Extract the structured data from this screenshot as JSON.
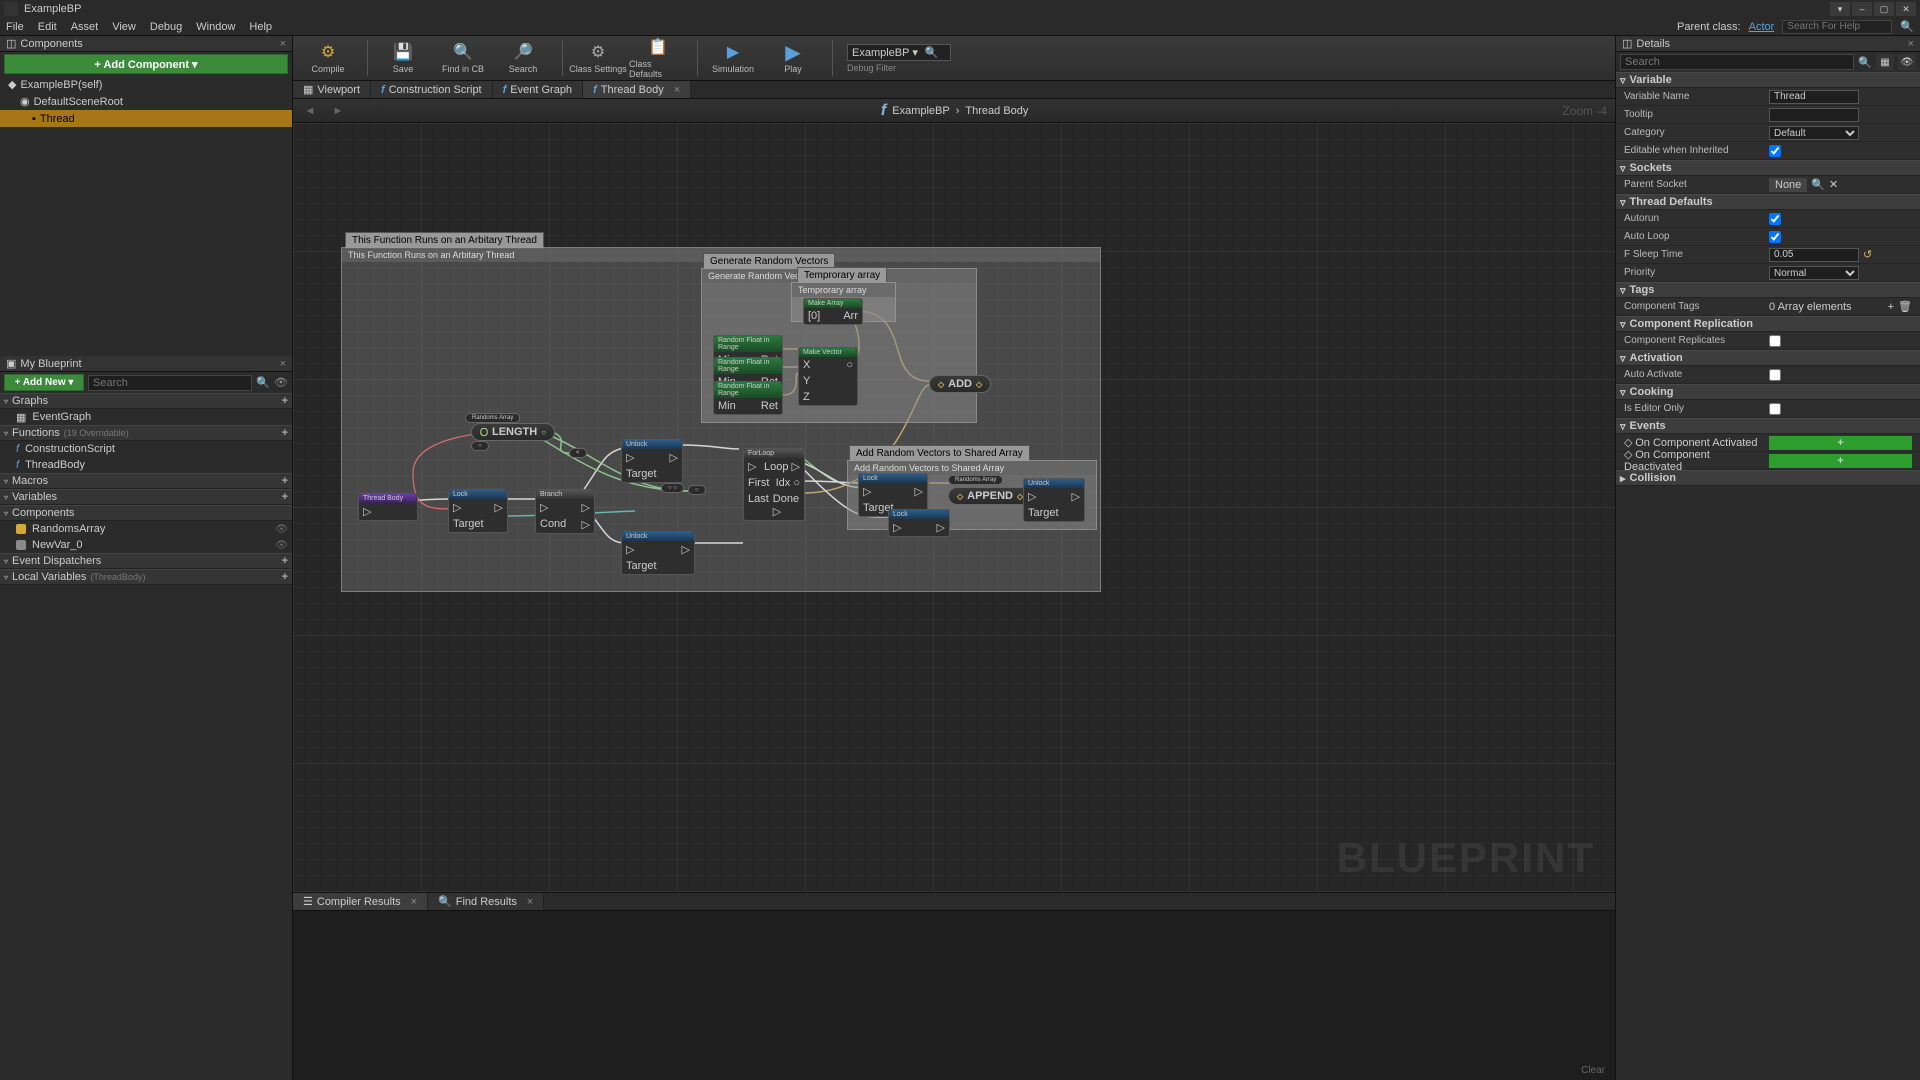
{
  "titlebar": {
    "title": "ExampleBP"
  },
  "window_buttons": {
    "min": "–",
    "max": "▢",
    "close": "✕",
    "down": "▾"
  },
  "menubar": {
    "items": [
      "File",
      "Edit",
      "Asset",
      "View",
      "Debug",
      "Window",
      "Help"
    ],
    "parent_class_label": "Parent class:",
    "parent_class": "Actor",
    "search_placeholder": "Search For Help"
  },
  "components_panel": {
    "title": "Components",
    "add_btn": "+ Add Component ▾",
    "items": [
      {
        "label": "ExampleBP(self)",
        "indent": 0
      },
      {
        "label": "DefaultSceneRoot",
        "indent": 1
      },
      {
        "label": "Thread",
        "indent": 2,
        "selected": true
      }
    ]
  },
  "my_blueprint": {
    "title": "My Blueprint",
    "add_btn": "+ Add New ▾",
    "search_placeholder": "Search",
    "sections": {
      "graphs": {
        "label": "Graphs",
        "items": [
          "EventGraph"
        ]
      },
      "functions": {
        "label": "Functions",
        "override": "(19 Overridable)",
        "items": [
          "ConstructionScript",
          "ThreadBody"
        ]
      },
      "macros": {
        "label": "Macros",
        "items": []
      },
      "variables": {
        "label": "Variables",
        "items": []
      },
      "components": {
        "label": "Components",
        "items": [
          {
            "label": "RandomsArray",
            "type": "vector"
          },
          {
            "label": "NewVar_0",
            "type": "gen"
          }
        ]
      },
      "dispatchers": {
        "label": "Event Dispatchers",
        "items": []
      },
      "locals": {
        "label": "Local Variables",
        "suffix": "(ThreadBody)",
        "items": []
      }
    }
  },
  "toolbar": {
    "buttons": [
      {
        "label": "Compile",
        "icon": "⚙"
      },
      {
        "label": "Save",
        "icon": "💾"
      },
      {
        "label": "Find in CB",
        "icon": "🔍"
      },
      {
        "label": "Search",
        "icon": "🔎"
      },
      {
        "label": "Class Settings",
        "icon": "⚙"
      },
      {
        "label": "Class Defaults",
        "icon": "📋"
      },
      {
        "label": "Simulation",
        "icon": "▶"
      },
      {
        "label": "Play",
        "icon": "▶"
      }
    ],
    "debug_select": "ExampleBP ▾",
    "debug_label": "Debug Filter"
  },
  "graph_tabs": [
    {
      "label": "Viewport",
      "icon": "▦"
    },
    {
      "label": "Construction Script",
      "icon": "f"
    },
    {
      "label": "Event Graph",
      "icon": "f"
    },
    {
      "label": "Thread Body",
      "icon": "f",
      "active": true
    }
  ],
  "breadcrumb": {
    "bp": "ExampleBP",
    "sep": "›",
    "fn": "Thread Body",
    "zoom": "Zoom -4"
  },
  "graph": {
    "watermark": "BLUEPRINT",
    "tooltip_main": "This Function Runs on an Arbitary Thread",
    "comment_main_title": "This Function Runs on an Arbitary Thread",
    "tooltip_gen": "Generate Random Vectors",
    "comment_gen_title": "Generate Random Vectors",
    "tooltip_tmp": "Temprorary array",
    "comment_tmp_title": "Temprorary array",
    "tooltip_add": "Add Random Vectors to Shared Array",
    "comment_add_title": "Add Random Vectors to Shared Array",
    "nodes": {
      "thread_body": "Thread Body",
      "lock": "Lock",
      "branch": "Branch",
      "unlock1": "Unlock",
      "unlock2": "Unlock",
      "unlock3": "Unlock",
      "forloop": "ForLoop",
      "lock2": "Lock",
      "make_array": "Make Array",
      "make_vector": "Make Vector",
      "rand1": "Random Float in Range",
      "rand2": "Random Float in Range",
      "rand3": "Random Float in Range",
      "length": "LENGTH",
      "add": "ADD",
      "append": "APPEND",
      "var_ref": "Randoms Array"
    }
  },
  "bottom_tabs": {
    "compiler": "Compiler Results",
    "find": "Find Results",
    "clear": "Clear"
  },
  "details": {
    "title": "Details",
    "search_placeholder": "Search",
    "sections": {
      "variable": {
        "label": "Variable",
        "rows": [
          {
            "k": "Variable Name",
            "type": "text",
            "v": "Thread"
          },
          {
            "k": "Tooltip",
            "type": "text",
            "v": ""
          },
          {
            "k": "Category",
            "type": "select",
            "v": "Default"
          },
          {
            "k": "Editable when Inherited",
            "type": "check",
            "v": true
          }
        ]
      },
      "sockets": {
        "label": "Sockets",
        "rows": [
          {
            "k": "Parent Socket",
            "type": "socket",
            "v": "None"
          }
        ]
      },
      "thread_defaults": {
        "label": "Thread Defaults",
        "rows": [
          {
            "k": "Autorun",
            "type": "check",
            "v": true
          },
          {
            "k": "Auto Loop",
            "type": "check",
            "v": true
          },
          {
            "k": "F Sleep Time",
            "type": "text",
            "v": "0.05"
          },
          {
            "k": "Priority",
            "type": "select",
            "v": "Normal"
          }
        ]
      },
      "tags": {
        "label": "Tags",
        "rows": [
          {
            "k": "Component Tags",
            "type": "array",
            "v": "0 Array elements"
          }
        ]
      },
      "replication": {
        "label": "Component Replication",
        "rows": [
          {
            "k": "Component Replicates",
            "type": "check",
            "v": false
          }
        ]
      },
      "activation": {
        "label": "Activation",
        "rows": [
          {
            "k": "Auto Activate",
            "type": "check",
            "v": false
          }
        ]
      },
      "cooking": {
        "label": "Cooking",
        "rows": [
          {
            "k": "Is Editor Only",
            "type": "check",
            "v": false
          }
        ]
      },
      "events": {
        "label": "Events",
        "rows": [
          {
            "k": "On Component Activated",
            "type": "event"
          },
          {
            "k": "On Component Deactivated",
            "type": "event"
          }
        ]
      },
      "collision": {
        "label": "Collision",
        "collapsed": true
      }
    }
  }
}
